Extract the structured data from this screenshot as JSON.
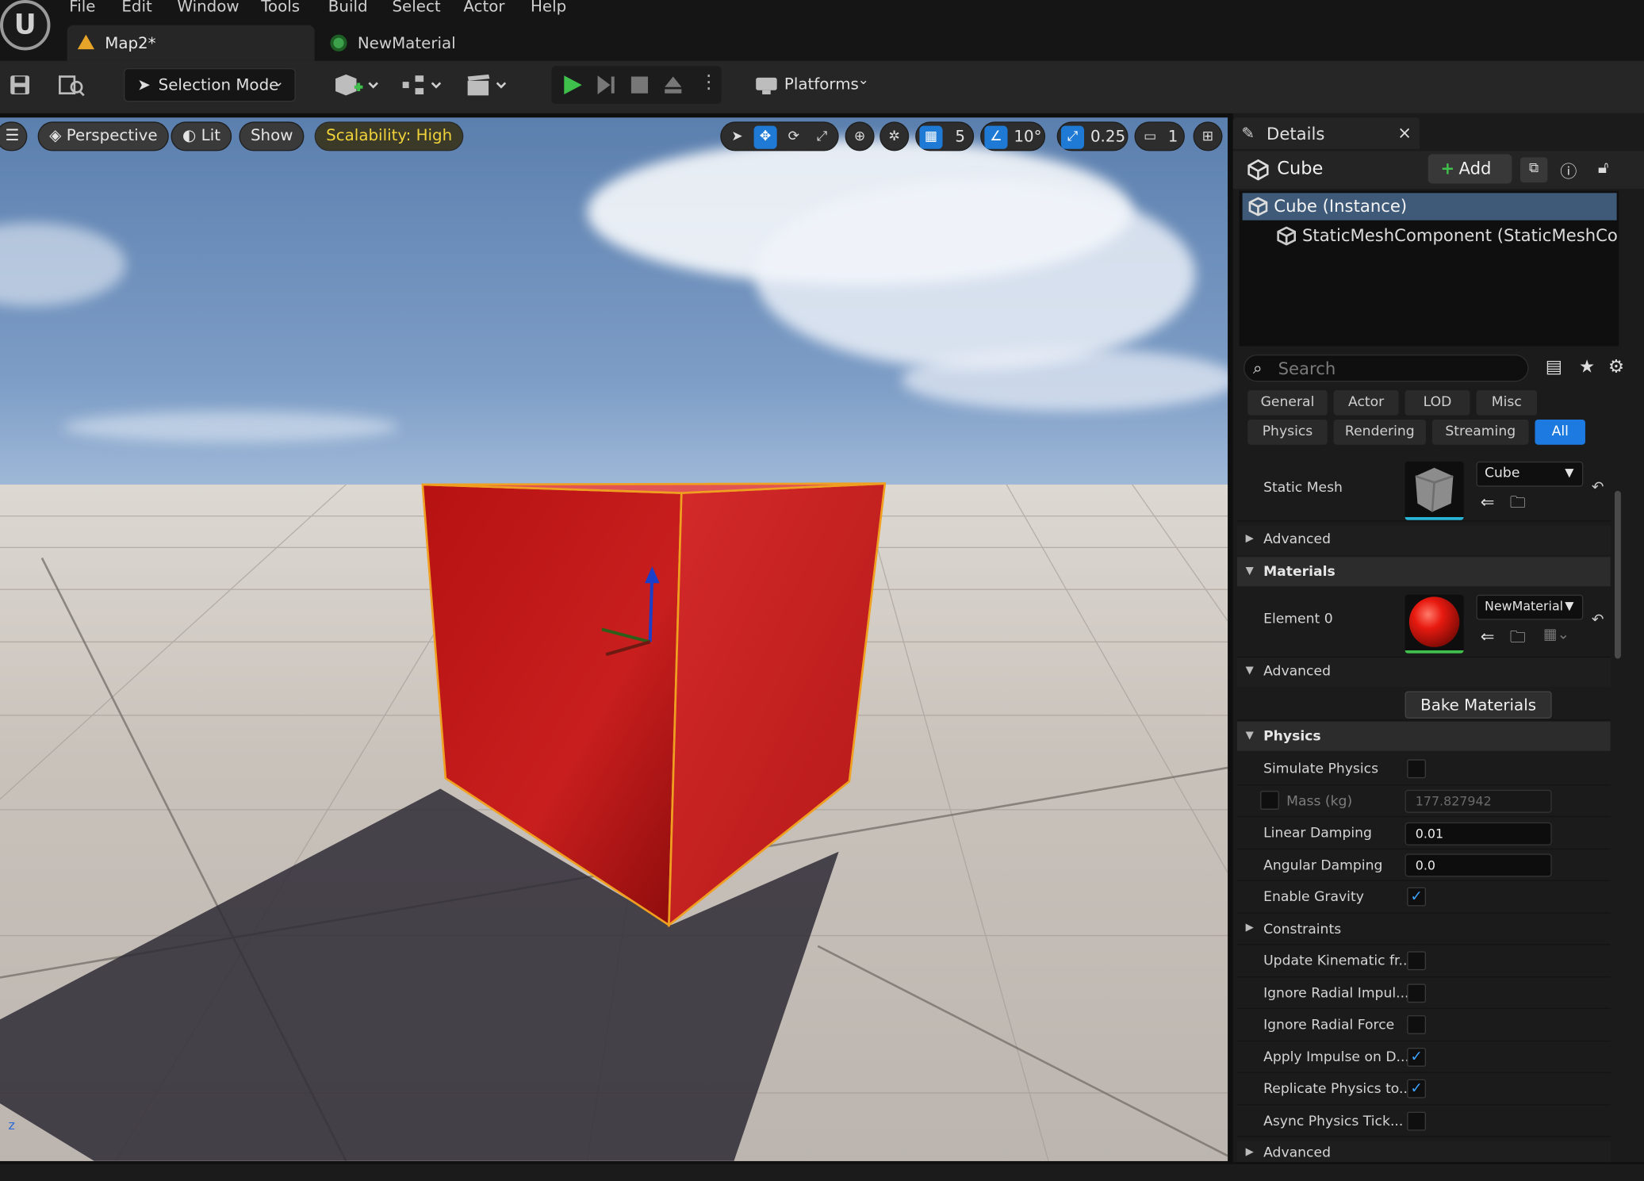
{
  "menu": {
    "items": [
      "File",
      "Edit",
      "Window",
      "Tools",
      "Build",
      "Select",
      "Actor",
      "Help"
    ]
  },
  "tabs": {
    "map": "Map2*",
    "material": "NewMaterial"
  },
  "toolbar": {
    "selection_mode": "Selection Mode",
    "platforms": "Platforms"
  },
  "viewport": {
    "perspective": "Perspective",
    "lit": "Lit",
    "show": "Show",
    "scalability": "Scalability: High",
    "grid_snap": "5",
    "rotation_snap": "10°",
    "scale_snap": "0.25",
    "camera_speed": "1",
    "cube_color": "#c81e1e"
  },
  "details": {
    "tab": "Details",
    "actor": "Cube",
    "add": "Add",
    "tree": {
      "instance": "Cube (Instance)",
      "component": "StaticMeshComponent (StaticMeshCompone"
    },
    "search_placeholder": "Search",
    "filters": [
      "General",
      "Actor",
      "LOD",
      "Misc",
      "Physics",
      "Rendering",
      "Streaming",
      "All"
    ],
    "static_mesh": {
      "label": "Static Mesh",
      "value": "Cube"
    },
    "advanced": "Advanced",
    "materials": {
      "section": "Materials",
      "element0": "Element 0",
      "value": "NewMaterial",
      "advanced": "Advanced",
      "bake": "Bake Materials"
    },
    "physics": {
      "section": "Physics",
      "simulate": "Simulate Physics",
      "mass_label": "Mass (kg)",
      "mass_value": "177.827942",
      "linear_label": "Linear Damping",
      "linear_value": "0.01",
      "angular_label": "Angular Damping",
      "angular_value": "0.0",
      "gravity": "Enable Gravity",
      "constraints": "Constraints",
      "update_kinematic": "Update Kinematic fr...",
      "ignore_impulse": "Ignore Radial Impul...",
      "ignore_force": "Ignore Radial Force",
      "apply_impulse": "Apply Impulse on D...",
      "replicate": "Replicate Physics to...",
      "async": "Async Physics Tick...",
      "advanced": "Advanced"
    },
    "accent": "#1d7ae0"
  }
}
